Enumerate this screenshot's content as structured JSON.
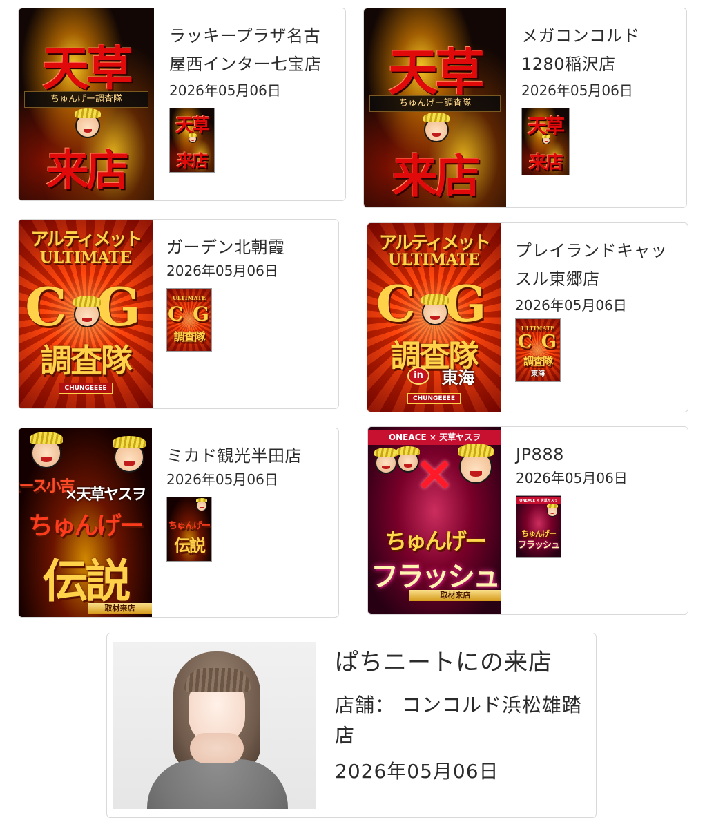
{
  "events": [
    {
      "store_name": "ラッキープラザ名古屋西インター七宝店",
      "date": "2026年05月06日",
      "poster": {
        "theme": "amakusa",
        "line1": "天草",
        "line2": "来店",
        "banner": "ちゅんげー調査隊"
      }
    },
    {
      "store_name": "メガコンコルド1280稲沢店",
      "date": "2026年05月06日",
      "poster": {
        "theme": "amakusa",
        "line1": "天草",
        "line2": "来店",
        "banner": "ちゅんげー調査隊"
      }
    },
    {
      "store_name": "ガーデン北朝霞",
      "date": "2026年05月06日",
      "poster": {
        "theme": "ultimate",
        "line1": "アルティメット",
        "line2": "ULTIMATE",
        "line3": "C G",
        "line4": "調査隊",
        "chip": "CHUNGEEEE"
      }
    },
    {
      "store_name": "プレイランドキャッスル東郷店",
      "date": "2026年05月06日",
      "poster": {
        "theme": "ultimate",
        "line1": "アルティメット",
        "line2": "ULTIMATE",
        "line3": "C G",
        "line4": "調査隊",
        "badge": "in",
        "area": "東海",
        "chip": "CHUNGEEEE"
      }
    },
    {
      "store_name": "ミカド観光半田店",
      "date": "2026年05月06日",
      "poster": {
        "theme": "densetsu",
        "line1": "エース小吉",
        "line2": "×天草ヤスヲ",
        "line3": "ちゅんげー",
        "line4": "伝説",
        "ribbon": "取材来店"
      }
    },
    {
      "store_name": "JP888",
      "date": "2026年05月06日",
      "poster": {
        "theme": "flash",
        "line1": "ONEACE × 天草ヤスヲ",
        "line2": "×",
        "line3": "ちゅんげー",
        "line4": "フラッシュ",
        "ribbon": "取材来店"
      }
    }
  ],
  "performer": {
    "title": "ぱちニートにの来店",
    "store_label": "店舗：",
    "store_name": "コンコルド浜松雄踏店",
    "date": "2026年05月06日"
  }
}
